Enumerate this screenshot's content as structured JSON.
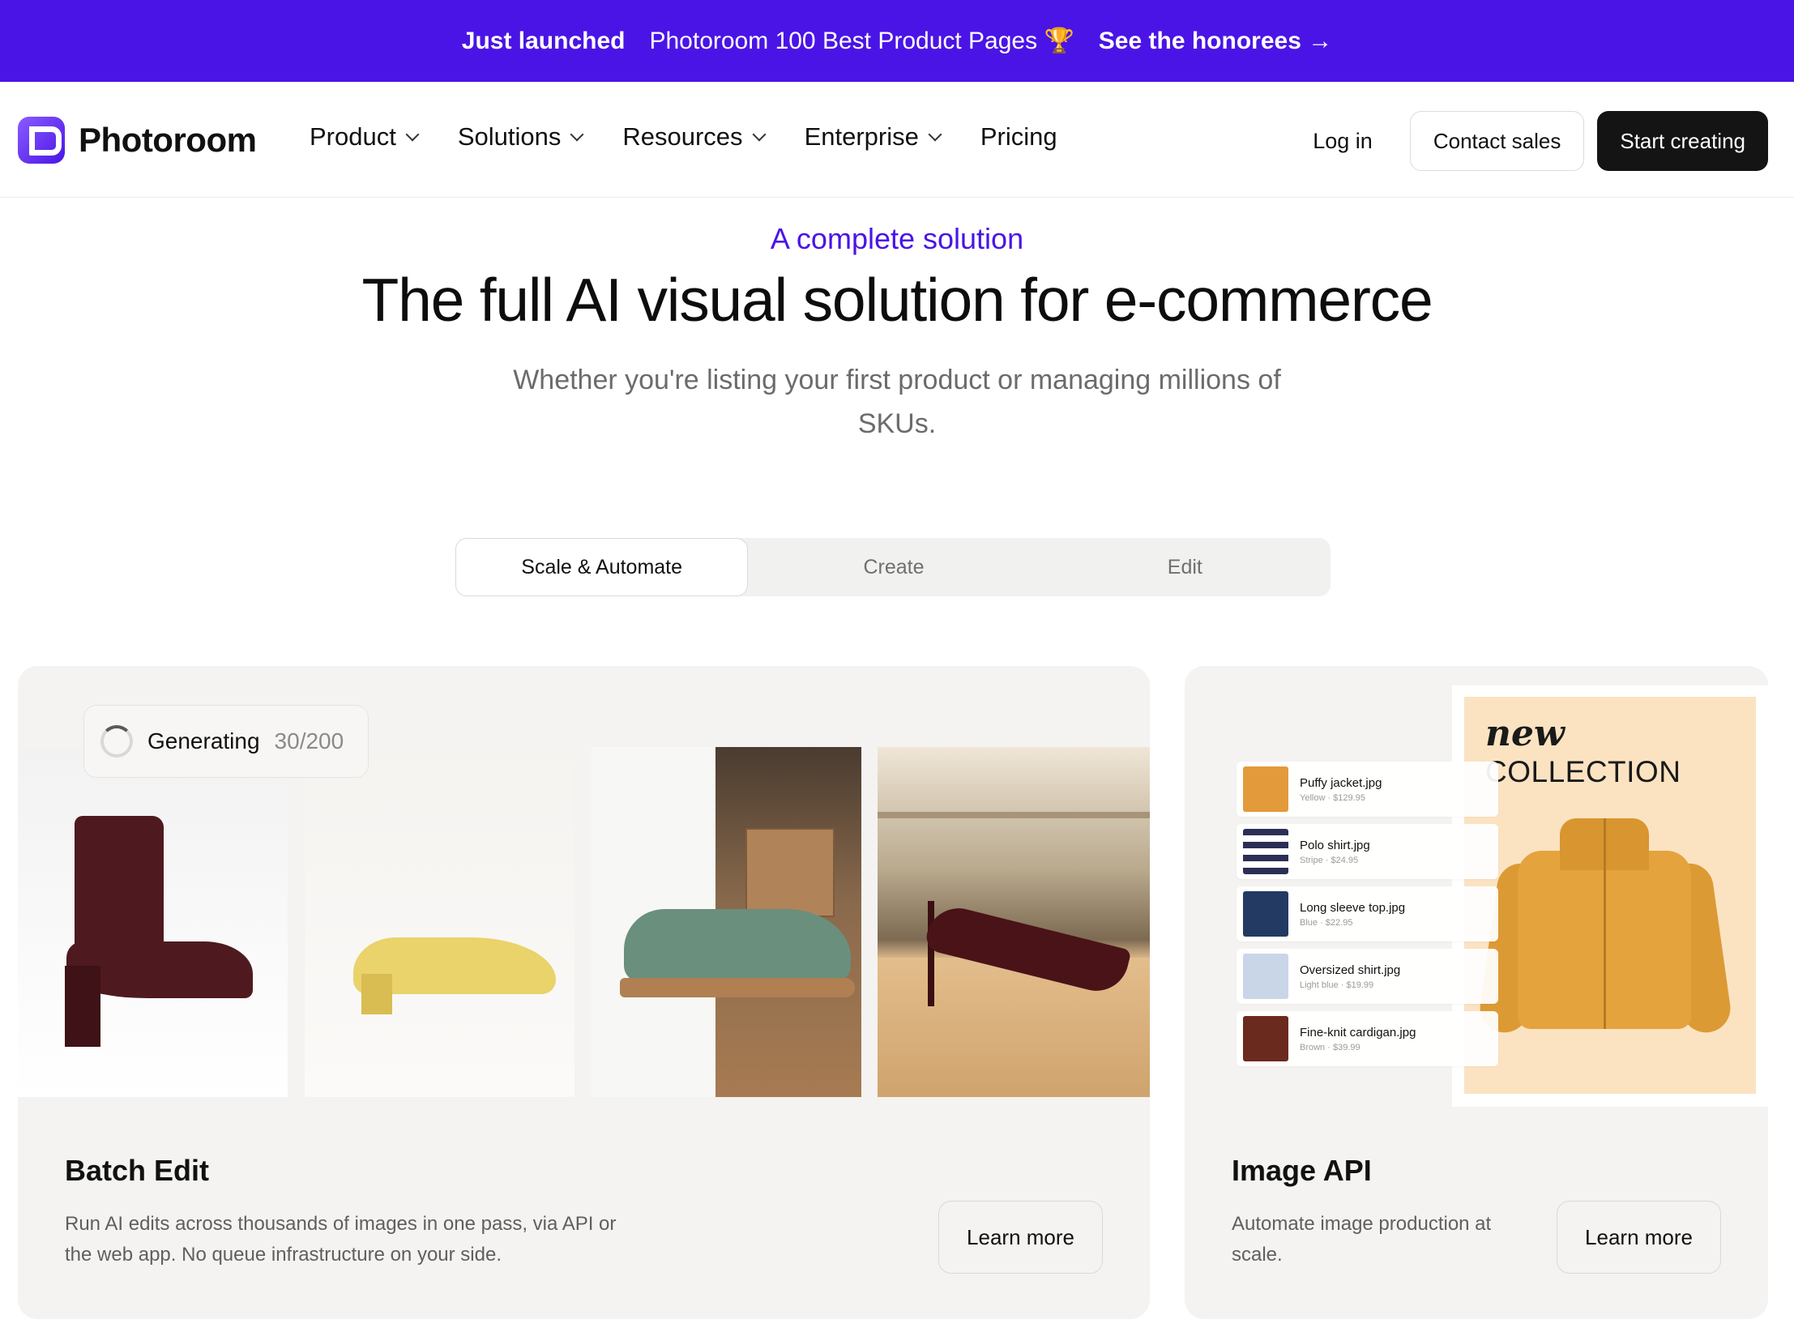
{
  "banner": {
    "badge": "Just launched",
    "message": "Photoroom 100 Best Product Pages 🏆",
    "link": "See the honorees →"
  },
  "header": {
    "logo_text": "Photoroom",
    "nav": [
      {
        "label": "Product",
        "dropdown": true
      },
      {
        "label": "Solutions",
        "dropdown": true
      },
      {
        "label": "Resources",
        "dropdown": true
      },
      {
        "label": "Enterprise",
        "dropdown": true
      },
      {
        "label": "Pricing",
        "dropdown": false
      }
    ],
    "login": "Log in",
    "contact": "Contact sales",
    "cta": "Start creating"
  },
  "hero": {
    "eyebrow": "A complete solution",
    "title": "The full AI visual solution for e-commerce",
    "subtitle": "Whether you're listing your first product or managing millions of SKUs."
  },
  "tabs": [
    {
      "label": "Scale & Automate",
      "active": true
    },
    {
      "label": "Create",
      "active": false
    },
    {
      "label": "Edit",
      "active": false
    }
  ],
  "cards": {
    "batch": {
      "status_label": "Generating",
      "status_count": "30/200",
      "title": "Batch Edit",
      "description": "Run AI edits across thousands of images in one pass, via API or the web app. No queue infrastructure on your side.",
      "button": "Learn more"
    },
    "api": {
      "poster_new": "new",
      "poster_collection": "COLLECTION",
      "products": [
        {
          "name": "Puffy jacket.jpg",
          "meta": "Yellow · $129.95",
          "color": "#e39a3b"
        },
        {
          "name": "Polo shirt.jpg",
          "meta": "Stripe · $24.95",
          "color": "#2b2f55"
        },
        {
          "name": "Long sleeve top.jpg",
          "meta": "Blue · $22.95",
          "color": "#233a63"
        },
        {
          "name": "Oversized shirt.jpg",
          "meta": "Light blue · $19.99",
          "color": "#c9d6e8"
        },
        {
          "name": "Fine-knit cardigan.jpg",
          "meta": "Brown · $39.99",
          "color": "#6b2a1e"
        }
      ],
      "title": "Image API",
      "description": "Automate image production at scale.",
      "button": "Learn more"
    }
  },
  "colors": {
    "brand": "#4a14e6",
    "dark_button": "#141414",
    "card_bg": "#f4f3f1"
  }
}
